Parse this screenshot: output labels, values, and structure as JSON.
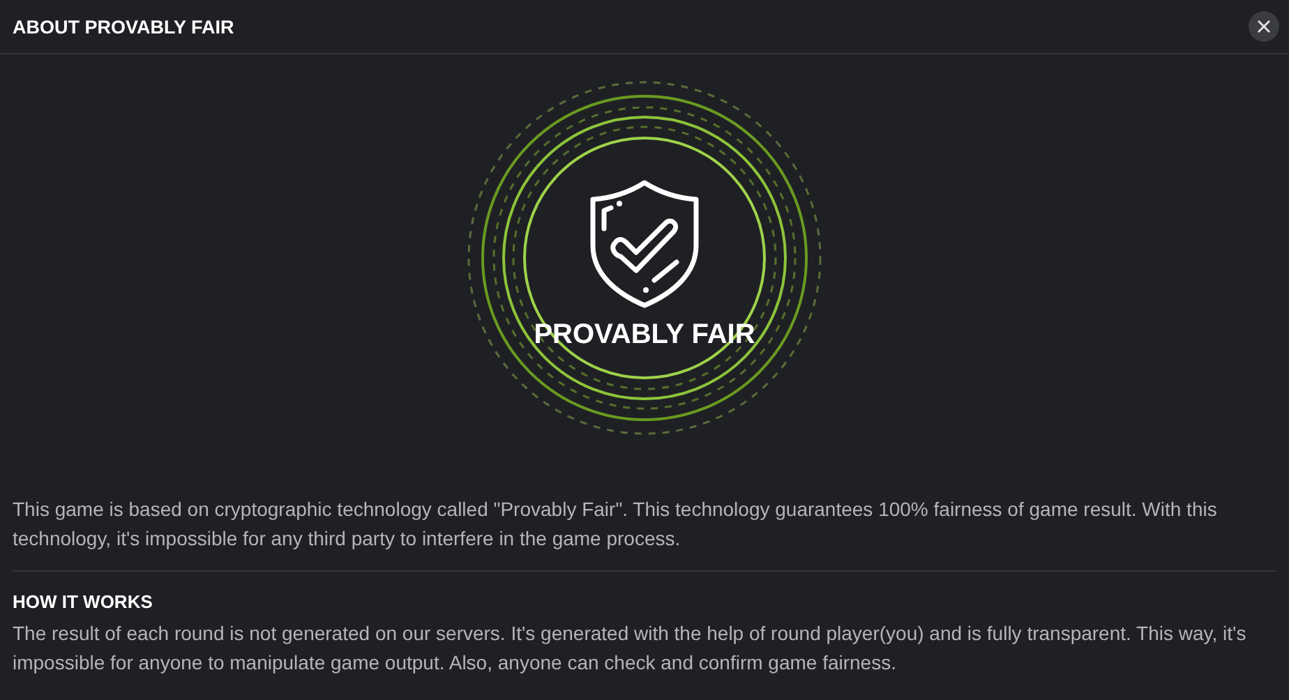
{
  "window": {
    "title": "ABOUT PROVABLY FAIR"
  },
  "emblem": {
    "title": "PROVABLY FAIR"
  },
  "intro": "This game is based on cryptographic technology called \"Provably Fair\". This technology guarantees 100% fairness of game result. With this technology, it's impossible for any third party to interfere in the game process.",
  "sections": [
    {
      "heading": "HOW IT WORKS",
      "text": "The result of each round is not generated on our servers. It's generated with the help of round player(you) and is fully transparent. This way, it's impossible for anyone to manipulate game output. Also, anyone can check and confirm game fairness."
    }
  ]
}
